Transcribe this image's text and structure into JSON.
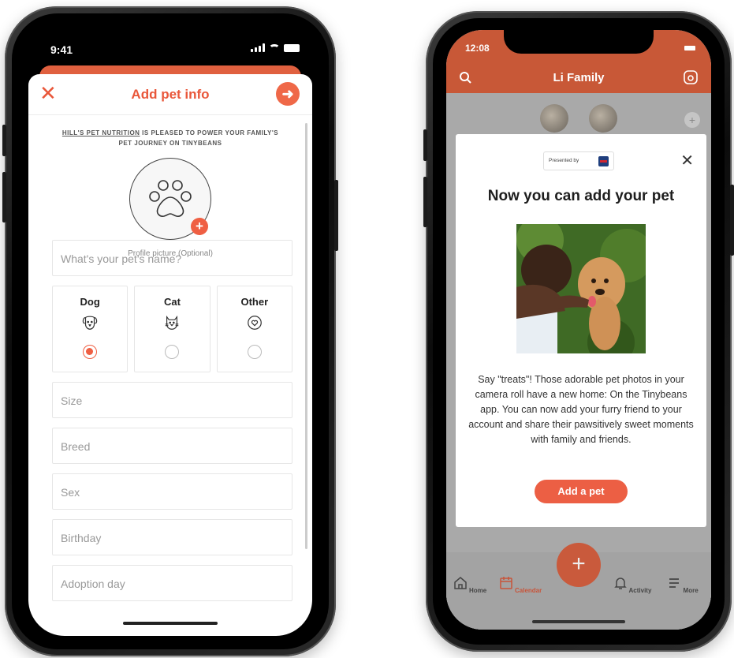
{
  "left_phone": {
    "status": {
      "time": "9:41"
    },
    "header": {
      "close_icon": "close-icon",
      "title": "Add pet info",
      "next_icon": "arrow-right-icon"
    },
    "sponsor": {
      "brand": "HILL'S PET NUTRITION",
      "text": " IS PLEASED TO POWER YOUR FAMILY'S PET JOURNEY ON TINYBEANS"
    },
    "profile": {
      "icon": "paw-icon",
      "caption": "Profile picture (Optional)"
    },
    "name_placeholder": "What's your pet's name?",
    "types": [
      {
        "label": "Dog",
        "icon": "dog-icon",
        "selected": true
      },
      {
        "label": "Cat",
        "icon": "cat-icon",
        "selected": false
      },
      {
        "label": "Other",
        "icon": "heart-icon",
        "selected": false
      }
    ],
    "fields": [
      "Size",
      "Breed",
      "Sex",
      "Birthday",
      "Adoption day"
    ],
    "colors": {
      "accent": "#ef5f43"
    }
  },
  "right_phone": {
    "status": {
      "time": "12:08"
    },
    "app_title": "Li Family",
    "modal": {
      "presented_by": "Presented by",
      "title": "Now you can add your pet",
      "body": "Say \"treats\"! Those adorable pet photos in your camera roll have a new home: On the Tinybeans app. You can now add your furry friend to your account and share their pawsitively sweet moments with family and friends.",
      "cta": "Add a pet"
    },
    "tabs": [
      {
        "label": "Home",
        "icon": "home-icon",
        "active": false
      },
      {
        "label": "Calendar",
        "icon": "calendar-icon",
        "active": true
      },
      {
        "label": "Activity",
        "icon": "bell-icon",
        "active": false
      },
      {
        "label": "More",
        "icon": "menu-icon",
        "active": false
      }
    ],
    "colors": {
      "brand": "#c85837",
      "cta": "#ec5f44"
    }
  }
}
